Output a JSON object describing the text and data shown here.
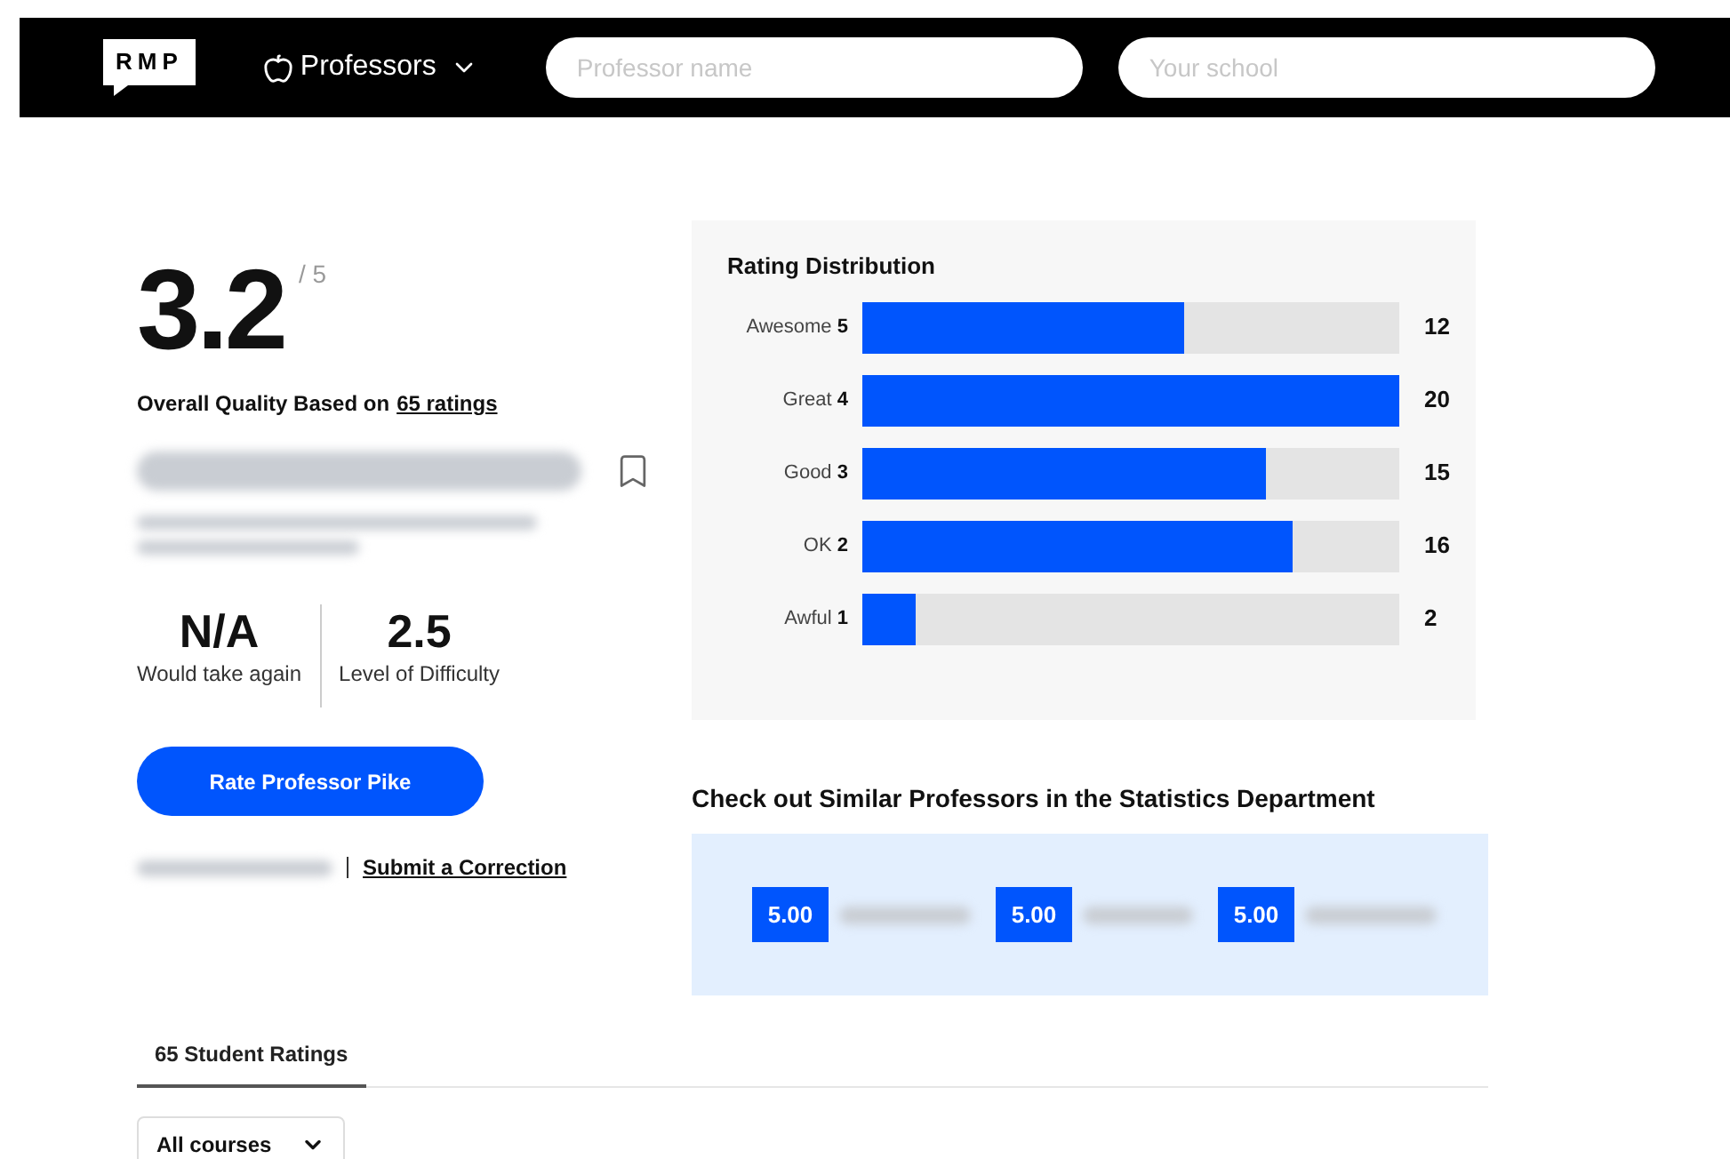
{
  "header": {
    "logo": "RMP",
    "nav": "Professors",
    "search_placeholder": "Professor name",
    "school_placeholder": "Your school"
  },
  "rating": {
    "score": "3.2",
    "out_of": "/ 5",
    "caption": "Overall Quality Based on",
    "ratings_link": "65 ratings"
  },
  "bookmarked": false,
  "stats": [
    {
      "value": "N/A",
      "label": "Would take again"
    },
    {
      "value": "2.5",
      "label": "Level of Difficulty"
    }
  ],
  "rate_button": "Rate Professor Pike",
  "correction_link": "Submit a Correction",
  "distribution": {
    "title": "Rating Distribution",
    "rows": [
      {
        "label": "Awesome",
        "number": "5",
        "count": "12",
        "level": 0.6
      },
      {
        "label": "Great",
        "number": "4",
        "count": "20",
        "level": 1
      },
      {
        "label": "Good",
        "number": "3",
        "count": "15",
        "level": 0.75
      },
      {
        "label": "OK",
        "number": "2",
        "count": "16",
        "level": 0.8
      },
      {
        "label": "Awful",
        "number": "1",
        "count": "2",
        "level": 0.1
      }
    ]
  },
  "similar": {
    "title": "Check out Similar Professors in the Statistics Department",
    "professors": [
      {
        "score": "5.00"
      },
      {
        "score": "5.00"
      },
      {
        "score": "5.00"
      }
    ]
  },
  "tabs": [
    {
      "label": "65 Student Ratings",
      "selected": true
    }
  ],
  "course_filter": "All courses"
}
